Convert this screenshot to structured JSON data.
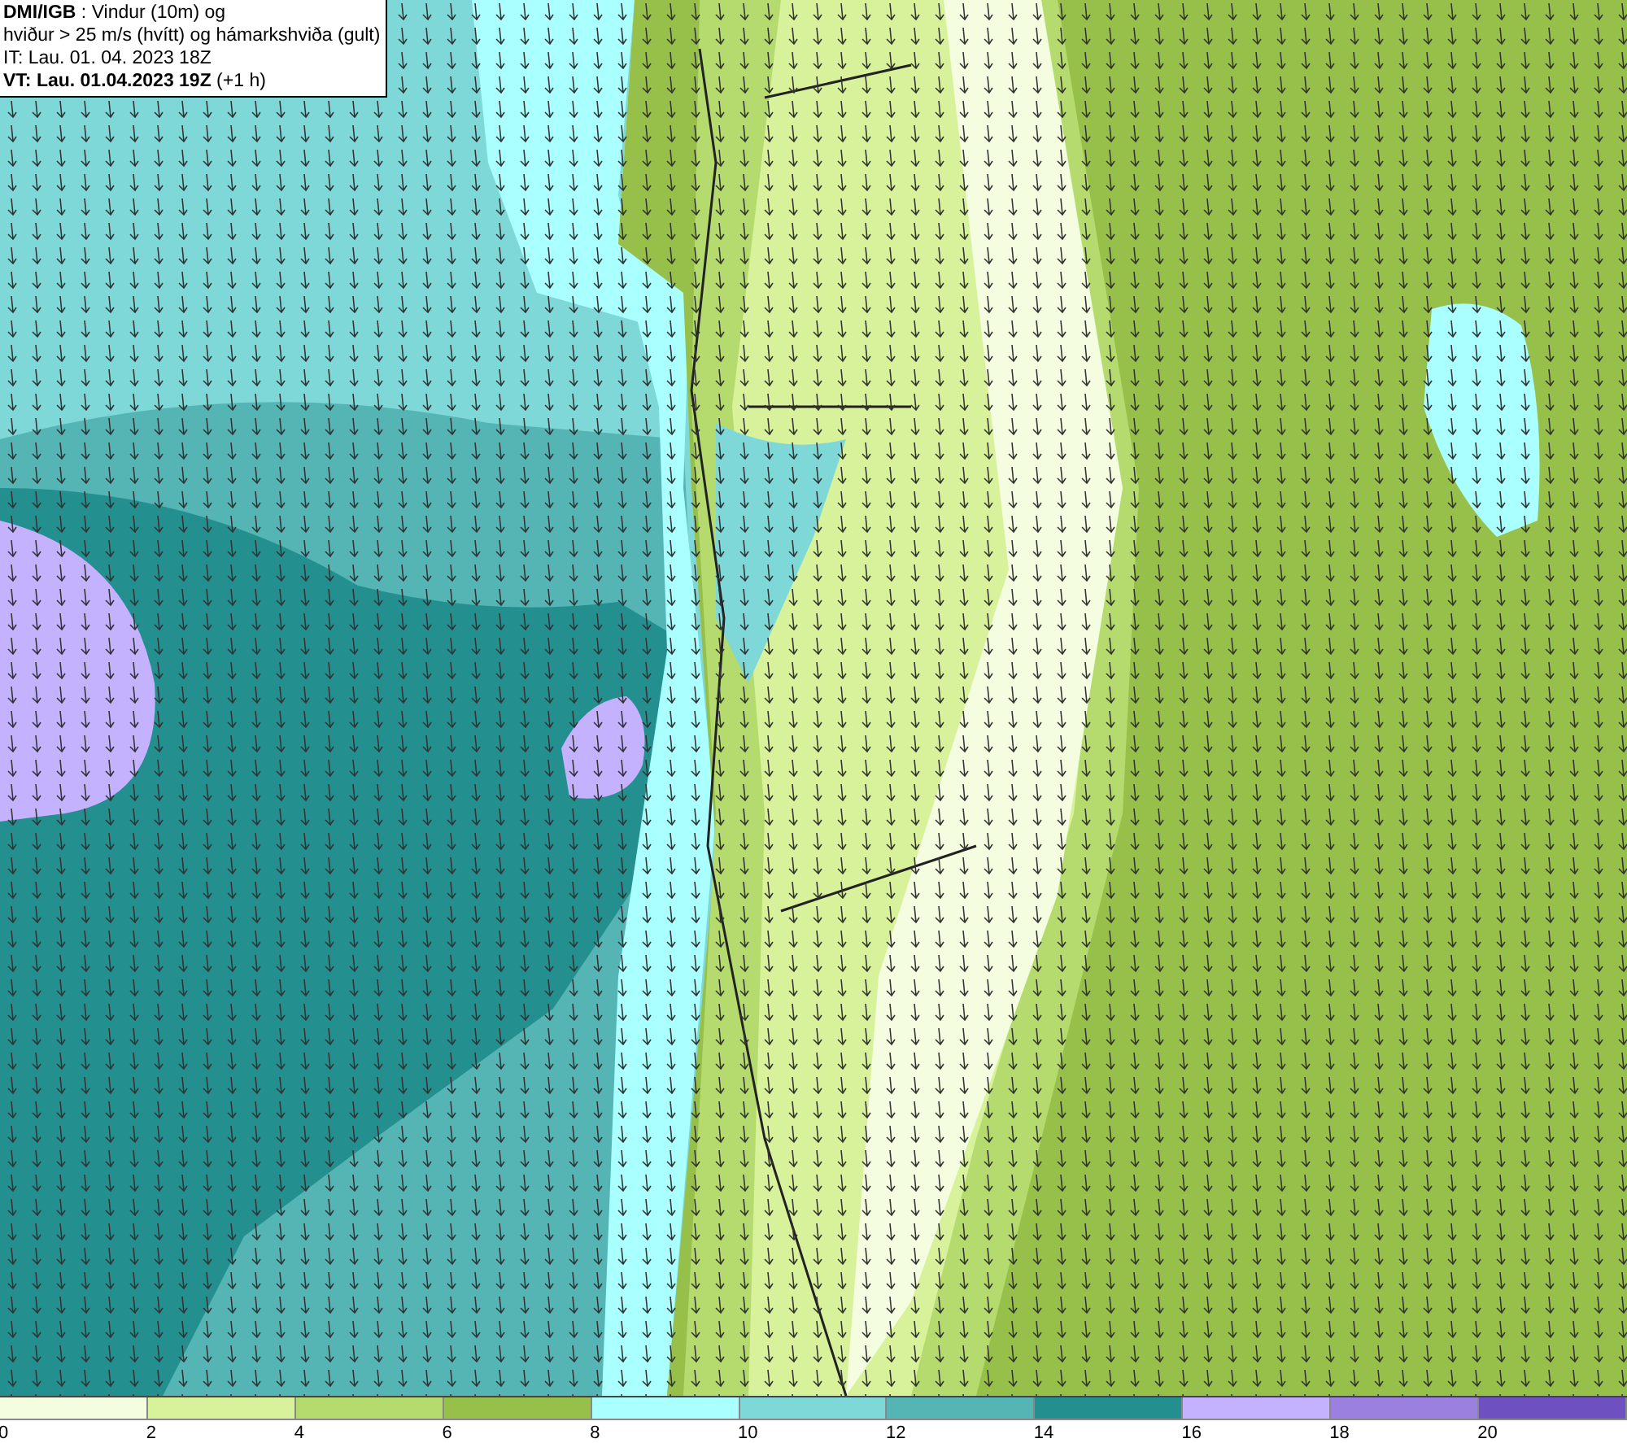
{
  "info_box": {
    "lines": [
      "**DMI/IGB** : Vindur (10m) og",
      "hviður > 25 m/s (hvítt) og hámarkshviða (gult)",
      "IT: Lau. 01. 04. 2023 18Z",
      "**VT: Lau. 01.04.2023 19Z** (+1 h)"
    ]
  },
  "legend": [
    {
      "label": "0",
      "color": "#f5fde0"
    },
    {
      "label": "2",
      "color": "#d8f29c"
    },
    {
      "label": "4",
      "color": "#b5db6e"
    },
    {
      "label": "6",
      "color": "#97c04a"
    },
    {
      "label": "8",
      "color": "#aaffff"
    },
    {
      "label": "10",
      "color": "#7fd8d8"
    },
    {
      "label": "12",
      "color": "#55b4b4"
    },
    {
      "label": "14",
      "color": "#238f8f"
    },
    {
      "label": "16",
      "color": "#c4b2ff"
    },
    {
      "label": "18",
      "color": "#9b80e0"
    },
    {
      "label": "20",
      "color": "#6f50c0"
    }
  ]
}
